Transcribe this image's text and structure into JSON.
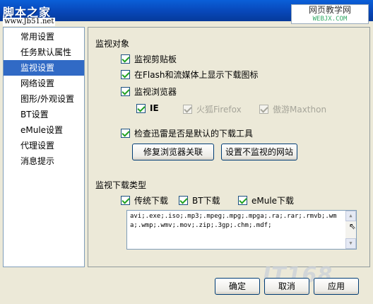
{
  "window": {
    "watermark_title": "脚本之家",
    "watermark_url": "www.Jb51.net",
    "watermark_right_1": "网页教学网",
    "watermark_right_2": "WEBJX.COM",
    "watermark_bottom": "IT168"
  },
  "sidebar": {
    "items": [
      {
        "label": "常用设置",
        "selected": false
      },
      {
        "label": "任务默认属性",
        "selected": false
      },
      {
        "label": "监视设置",
        "selected": true
      },
      {
        "label": "网络设置",
        "selected": false
      },
      {
        "label": "图形/外观设置",
        "selected": false
      },
      {
        "label": "BT设置",
        "selected": false
      },
      {
        "label": "eMule设置",
        "selected": false
      },
      {
        "label": "代理设置",
        "selected": false
      },
      {
        "label": "消息提示",
        "selected": false
      }
    ]
  },
  "monitor": {
    "group_title": "监视对象",
    "clipboard": {
      "label": "监视剪贴板",
      "checked": true
    },
    "flash": {
      "label": "在Flash和流媒体上显示下载图标",
      "checked": true
    },
    "browser": {
      "label": "监视浏览器",
      "checked": true
    },
    "ie": {
      "label": "IE",
      "checked": true
    },
    "firefox": {
      "label": "火狐Firefox",
      "checked": true,
      "disabled": true
    },
    "maxthon": {
      "label": "傲游Maxthon",
      "checked": true,
      "disabled": true
    },
    "default_tool": {
      "label": "检查迅雷是否是默认的下载工具",
      "checked": true
    },
    "repair_button": "修复浏览器关联",
    "exclude_button": "设置不监视的网站"
  },
  "types": {
    "group_title": "监视下载类型",
    "traditional": {
      "label": "传统下载",
      "checked": true
    },
    "bt": {
      "label": "BT下载",
      "checked": true
    },
    "emule": {
      "label": "eMule下载",
      "checked": true
    },
    "extensions": "avi;.exe;.iso;.mp3;.mpeg;.mpg;.mpga;.ra;.rar;.rmvb;.wma;.wmp;.wmv;.mov;.zip;.3gp;.chm;.mdf;"
  },
  "footer": {
    "ok": "确定",
    "cancel": "取消",
    "apply": "应用"
  },
  "icons": {
    "up_arrow": "▲",
    "down_arrow": "▼",
    "cursor": "⇖"
  }
}
